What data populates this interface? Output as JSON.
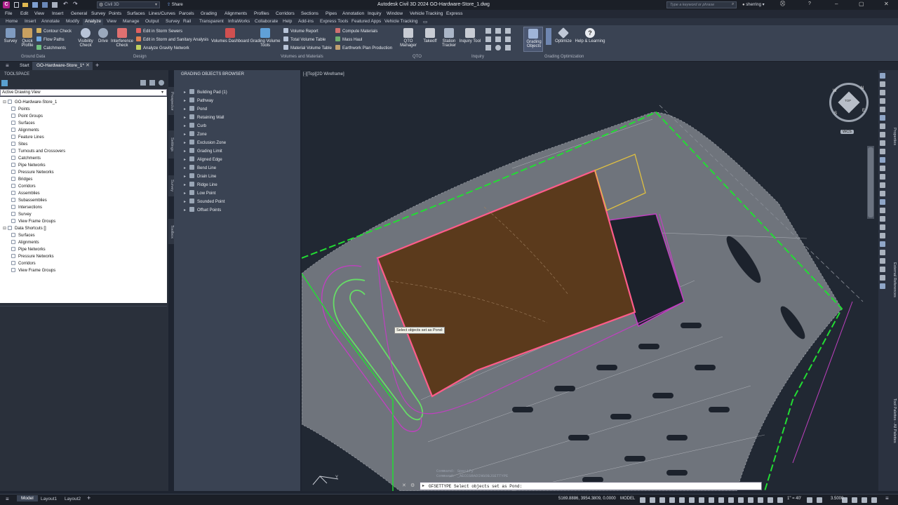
{
  "titlebar": {
    "app_badge": "C",
    "workspace": "Civil 3D",
    "share": "Share",
    "title": "Autodesk Civil 3D 2024   GO-Hardware-Store_1.dwg",
    "search_placeholder": "Type a keyword or phrase",
    "user": "sherring"
  },
  "menubar": [
    "File",
    "Edit",
    "View",
    "Insert",
    "General",
    "Survey",
    "Points",
    "Surfaces",
    "Lines/Curves",
    "Parcels",
    "Grading",
    "Alignments",
    "Profiles",
    "Corridors",
    "Sections",
    "Pipes",
    "Annotation",
    "Inquiry",
    "Window",
    "Vehicle Tracking",
    "Express"
  ],
  "ribbon_tabs": [
    "Home",
    "Insert",
    "Annotate",
    "Modify",
    "Analyze",
    "View",
    "Manage",
    "Output",
    "Survey",
    "Rail",
    "Transparent",
    "InfraWorks",
    "Collaborate",
    "Help",
    "Add-ins",
    "Express Tools",
    "Featured Apps",
    "Vehicle Tracking"
  ],
  "ribbon_active_tab": "Analyze",
  "ribbon": {
    "ground_data": {
      "panel": "Ground Data",
      "survey": "Survey",
      "quick_profile": "Quick Profile",
      "contour_check": "Contour Check",
      "flow_paths": "Flow Paths",
      "catchments": "Catchments"
    },
    "design": {
      "panel": "Design",
      "visibility_check": "Visibility Check",
      "drive": "Drive",
      "interference_check": "Interference Check",
      "edit_storm_sewers": "Edit in Storm Sewers",
      "edit_storm_sanitary": "Edit in Storm and Sanitary Analysis",
      "analyze_gravity": "Analyze Gravity Network"
    },
    "volumes": {
      "panel": "Volumes and Materials",
      "volumes_dashboard": "Volumes Dashboard",
      "grading_volume_tools": "Grading Volume Tools",
      "volume_report": "Volume Report",
      "total_volume_table": "Total Volume Table",
      "material_volume_table": "Material Volume Table",
      "compute_materials": "Compute Materials",
      "mass_haul": "Mass Haul",
      "earthwork_plan": "Earthwork Plan Production"
    },
    "qto": {
      "panel": "QTO",
      "qto_manager": "QTO Manager",
      "takeoff": "Takeoff"
    },
    "inquiry": {
      "panel": "Inquiry",
      "station_tracker": "Station Tracker",
      "inquiry_tool": "Inquiry Tool"
    },
    "grading_opt": {
      "panel": "Grading Optimization",
      "grading_objects": "Grading Objects",
      "optimize": "Optimize",
      "help_learning": "Help & Learning"
    }
  },
  "doctabs": {
    "start": "Start",
    "active": "GO-Hardware-Store_1*"
  },
  "toolspace": {
    "title": "TOOLSPACE",
    "view_select": "Active Drawing View",
    "root": "GO-Hardware-Store_1",
    "items": [
      "Points",
      "Point Groups",
      "Surfaces",
      "Alignments",
      "Feature Lines",
      "Sites",
      "Turnouts and Crossovers",
      "Catchments",
      "Pipe Networks",
      "Pressure Networks",
      "Bridges",
      "Corridors",
      "Assemblies",
      "Subassemblies",
      "Intersections",
      "Survey",
      "View Frame Groups"
    ],
    "shortcuts_root": "Data Shortcuts []",
    "shortcut_items": [
      "Surfaces",
      "Alignments",
      "Pipe Networks",
      "Pressure Networks",
      "Corridors",
      "View Frame Groups"
    ],
    "side_tabs": [
      "Prospector",
      "Settings",
      "Survey",
      "Toolbox"
    ]
  },
  "grading_browser": {
    "title": "GRADING OBJECTS BROWSER",
    "items": [
      "Building Pad (1)",
      "Pathway",
      "Pond",
      "Retaining Wall",
      "Curb",
      "Zone",
      "Exclusion Zone",
      "Grading Limit",
      "Aligned Edge",
      "Bend Line",
      "Drain Line",
      "Ridge Line",
      "Low Point",
      "Sounded Point",
      "Offset Points"
    ]
  },
  "viewport": {
    "label": "[-][Top][2D Wireframe]",
    "tooltip": "Select objects set as Pond:",
    "wcs": "WCS",
    "ucs_y": "Y",
    "compass": [
      "N",
      "S",
      "E",
      "W",
      "TOP"
    ]
  },
  "command": {
    "history1": "Command:  Specify",
    "history2": "Command:  _AECCGRADINGOBJSETTYPE",
    "prompt": "GFSETTYPE Select objects set as Pond:"
  },
  "right_panel_tabs": [
    "Properties",
    "External References",
    "Tool Palettes - All Palettes"
  ],
  "status": {
    "tabs": [
      "Model",
      "Layout1",
      "Layout2"
    ],
    "coords": "5169.8886, 3954.3809, 0.0000",
    "space": "MODEL",
    "scale": "1\" = 40'",
    "value": "3.5000"
  },
  "colors": {
    "accent": "#2a7fd1",
    "building": "#5b3a1c",
    "building_edge": "#ff5c8a",
    "boundary_green": "#22dd33",
    "magenta": "#c040c0"
  }
}
